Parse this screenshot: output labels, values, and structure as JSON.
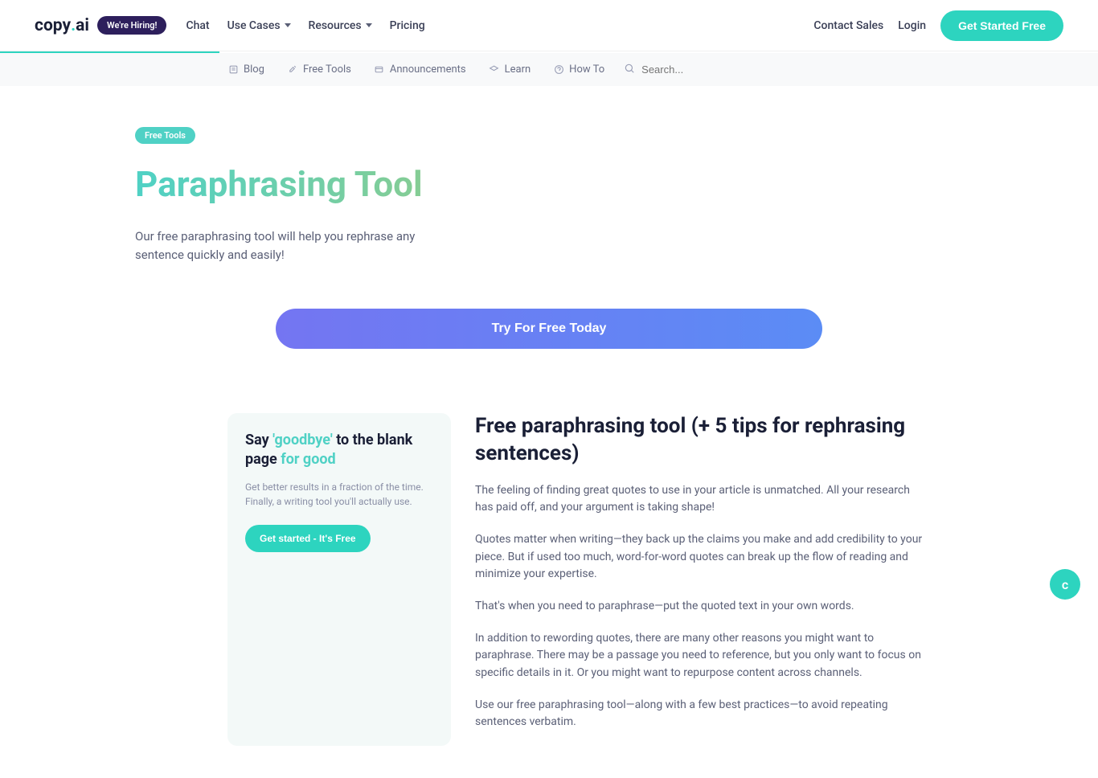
{
  "header": {
    "logo_text": "copy",
    "logo_dot": ".",
    "logo_ai": "ai",
    "hiring_badge": "We're Hiring!",
    "nav": [
      {
        "label": "Chat",
        "dropdown": false
      },
      {
        "label": "Use Cases",
        "dropdown": true
      },
      {
        "label": "Resources",
        "dropdown": true
      },
      {
        "label": "Pricing",
        "dropdown": false
      }
    ],
    "contact_sales": "Contact Sales",
    "login": "Login",
    "cta": "Get Started Free"
  },
  "subnav": {
    "items": [
      {
        "label": "Blog",
        "icon": "blog"
      },
      {
        "label": "Free Tools",
        "icon": "tools"
      },
      {
        "label": "Announcements",
        "icon": "announce"
      },
      {
        "label": "Learn",
        "icon": "learn"
      },
      {
        "label": "How To",
        "icon": "howto"
      }
    ],
    "search_placeholder": "Search..."
  },
  "hero": {
    "tag": "Free Tools",
    "title": "Paraphrasing Tool",
    "description": "Our free paraphrasing tool will help you rephrase any sentence quickly and easily!"
  },
  "cta_button": "Try For Free Today",
  "sidebar_card": {
    "title_pre": "Say ",
    "title_goodbye": "'goodbye'",
    "title_mid": " to the blank page ",
    "title_forgood": "for good",
    "description": "Get better results in a fraction of the time. Finally, a writing tool you'll actually use.",
    "button": "Get started - It's Free"
  },
  "article": {
    "title": "Free paraphrasing tool (+ 5 tips for rephrasing sentences)",
    "paragraphs": [
      "The feeling of finding great quotes to use in your article is unmatched. All your research has paid off, and your argument is taking shape!",
      "Quotes matter when writing—they back up the claims you make and add credibility to your piece. But if used too much, word-for-word quotes can break up the flow of reading and minimize your expertise.",
      "That's when you need to paraphrase—put the quoted text in your own words.",
      "In addition to rewording quotes, there are many other reasons you might want to paraphrase. There may be a passage you need to reference, but you only want to focus on specific details in it. Or you might want to repurpose content across channels.",
      "Use our free paraphrasing tool—along with a few best practices—to avoid repeating sentences verbatim."
    ]
  },
  "chat_float": "c"
}
